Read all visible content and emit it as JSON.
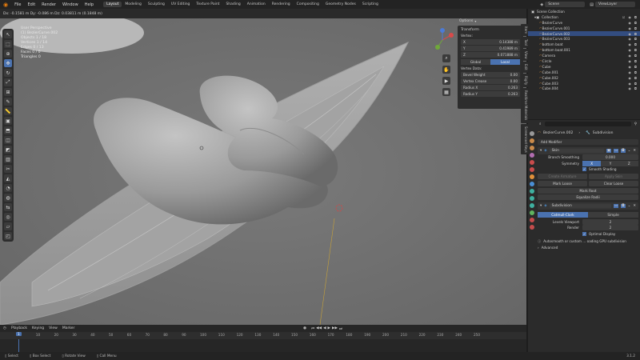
{
  "topbar": {
    "menus": [
      "File",
      "Edit",
      "Render",
      "Window",
      "Help"
    ],
    "workspaces": [
      "Layout",
      "Modeling",
      "Sculpting",
      "UV Editing",
      "Texture Paint",
      "Shading",
      "Animation",
      "Rendering",
      "Compositing",
      "Geometry Nodes",
      "Scripting"
    ],
    "scene": "Scene",
    "view_layer": "ViewLayer"
  },
  "header2": {
    "transform_readout": "Dx: -0.1581 m   Dy: -0.086 m   Dz: 0.03811 m (0.1848 m)",
    "orientation_label": "Orientation:",
    "orientation_value": "Default",
    "drag_label": "Drag:",
    "drag_value": "Select Box",
    "options_label": "Options"
  },
  "viewport_overlay": {
    "view_name": "User Perspective",
    "object_name": "(1) BezierCurve.002",
    "stats": [
      "Objects  1 / 18",
      "Vertices  1 / 14",
      "Edges  0 / 13",
      "Faces  0 / 0",
      "Triangles  0"
    ]
  },
  "npanel": {
    "title": "Transform",
    "vertex_label": "Vertex:",
    "coords": [
      {
        "k": "X",
        "v": "0.14388 m"
      },
      {
        "k": "Y",
        "v": "0.41989 m"
      },
      {
        "k": "Z",
        "v": "0.071888 m"
      }
    ],
    "space": [
      "Global",
      "Local"
    ],
    "vertex_data_label": "Vertex Data:",
    "fields": [
      {
        "k": "Bevel Weight",
        "v": "0.00"
      },
      {
        "k": "Vertex Crease",
        "v": "0.00"
      },
      {
        "k": "Radius X",
        "v": "0.263"
      },
      {
        "k": "Radius Y",
        "v": "0.263"
      }
    ]
  },
  "side_tabs": [
    "Item",
    "Tool",
    "View",
    "Edit",
    "Rigify",
    "Realtime Materials",
    "Screencast Keys"
  ],
  "outliner": {
    "root": "Scene Collection",
    "collection": "Collection",
    "items": [
      "BezierCurve",
      "BezierCurve.001",
      "BezierCurve.002",
      "BezierCurve.003",
      "bottom boat",
      "bottom boat.001",
      "Camera",
      "Circle",
      "Cube",
      "Cube.001",
      "Cube.002",
      "Cube.003",
      "Cube.004"
    ],
    "selected_index": 2
  },
  "props": {
    "object": "BezierCurve.002",
    "modifier_tab": "Subdivision",
    "add_modifier": "Add Modifier",
    "skin": {
      "name": "Skin",
      "branch_smoothing_label": "Branch Smoothing",
      "branch_smoothing_value": "0.000",
      "symmetry_label": "Symmetry",
      "symmetry_axes": [
        "X",
        "Y",
        "Z"
      ],
      "smooth_shading": "Smooth Shading",
      "create_armature": "Create Armature",
      "apply_skin": "Apply Skin",
      "mark_loose": "Mark Loose",
      "clear_loose": "Clear Loose",
      "mark_root": "Mark Root",
      "equalize_radii": "Equalize Radii"
    },
    "subdiv": {
      "name": "Subdivision",
      "modes": [
        "Catmull-Clark",
        "Simple"
      ],
      "levels_label": "Levels Viewport",
      "levels_value": "2",
      "render_label": "Render",
      "render_value": "2",
      "optimal_display": "Optimal Display",
      "notice": "Autosmooth or custom ... oading GPU subdivision",
      "advanced": "Advanced"
    }
  },
  "timeline": {
    "menus": [
      "Playback",
      "Keying",
      "View",
      "Marker"
    ],
    "current_frame": "1",
    "ticks": [
      "1",
      "10",
      "20",
      "30",
      "40",
      "50",
      "60",
      "70",
      "80",
      "90",
      "100",
      "110",
      "120",
      "130",
      "140",
      "150",
      "160",
      "170",
      "180",
      "190",
      "200",
      "210",
      "220",
      "230",
      "240",
      "250"
    ]
  },
  "statusbar": {
    "items": [
      "Select",
      "Box Select",
      "Rotate View",
      "Call Menu"
    ],
    "version": "3.1.2"
  }
}
